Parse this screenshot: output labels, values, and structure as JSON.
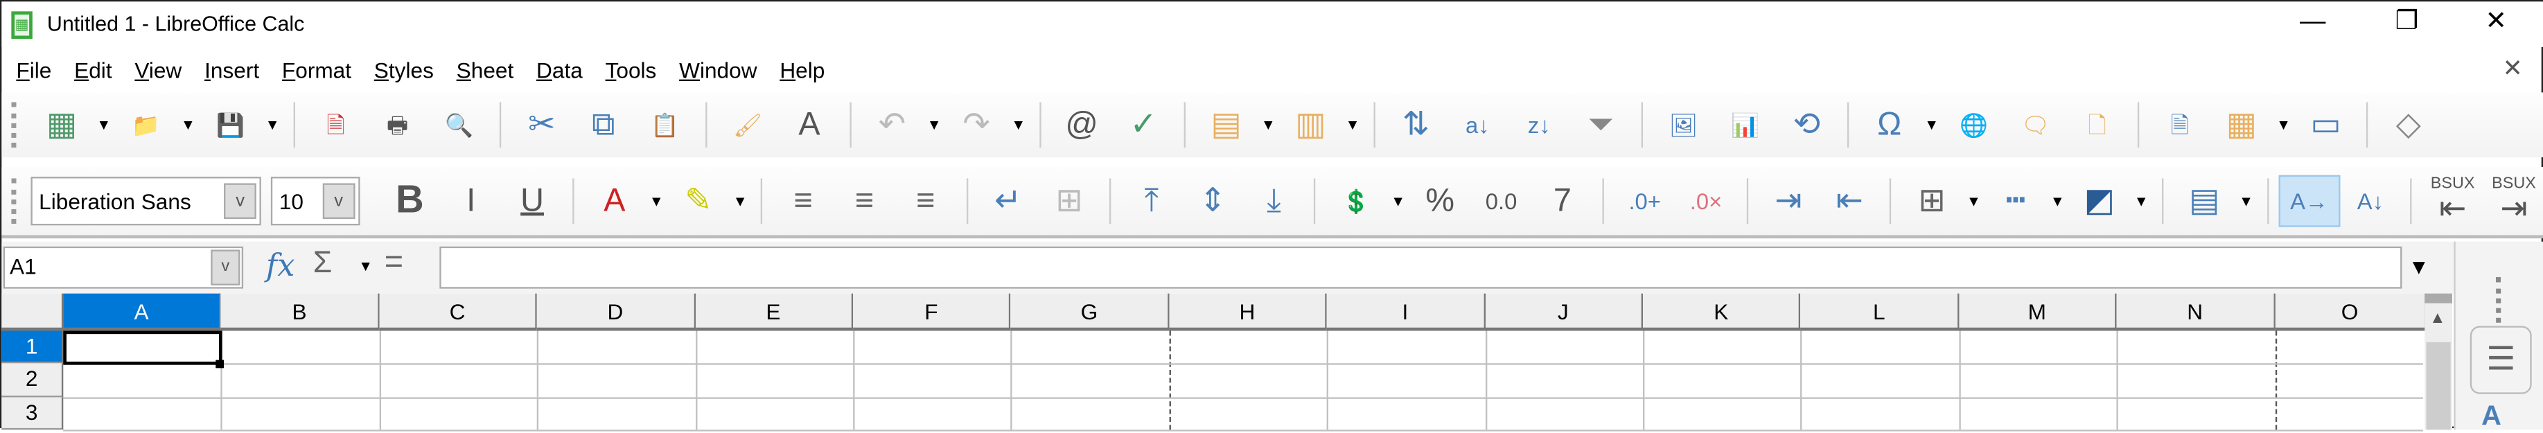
{
  "window": {
    "title": "Untitled 1 - LibreOffice Calc",
    "minimize": "—",
    "restore": "❐",
    "close": "✕"
  },
  "menu": [
    "File",
    "Edit",
    "View",
    "Insert",
    "Format",
    "Styles",
    "Sheet",
    "Data",
    "Tools",
    "Window",
    "Help"
  ],
  "doc_close": "✕",
  "toolbar_standard": [
    {
      "name": "new-spreadsheet-icon",
      "glyph": "▦",
      "color": "#4f9a6b",
      "dd": true
    },
    {
      "name": "open-folder-icon",
      "glyph": "📁",
      "color": "#e8c07a",
      "dd": true
    },
    {
      "name": "save-icon",
      "glyph": "💾",
      "color": "#8b5aa8",
      "dd": true
    },
    {
      "sep": true
    },
    {
      "name": "export-pdf-icon",
      "glyph": "🗎",
      "color": "#c33"
    },
    {
      "name": "print-icon",
      "glyph": "🖶",
      "color": "#555"
    },
    {
      "name": "print-preview-icon",
      "glyph": "🔍",
      "color": "#4a7fb8"
    },
    {
      "sep": true
    },
    {
      "name": "cut-icon",
      "glyph": "✂",
      "color": "#4a7fb8"
    },
    {
      "name": "copy-icon",
      "glyph": "⧉",
      "color": "#4a7fb8"
    },
    {
      "name": "paste-icon",
      "glyph": "📋",
      "color": "#bbb"
    },
    {
      "sep": true
    },
    {
      "name": "clone-formatting-icon",
      "glyph": "🖌",
      "color": "#e8b060"
    },
    {
      "name": "clear-formatting-icon",
      "glyph": "A",
      "color": "#555"
    },
    {
      "sep": true
    },
    {
      "name": "undo-icon",
      "glyph": "↶",
      "color": "#bbb",
      "dd": true
    },
    {
      "name": "redo-icon",
      "glyph": "↷",
      "color": "#bbb",
      "dd": true
    },
    {
      "sep": true
    },
    {
      "name": "find-replace-icon",
      "glyph": "@",
      "color": "#555"
    },
    {
      "name": "spelling-icon",
      "glyph": "✓",
      "color": "#4a9a6b"
    },
    {
      "sep": true
    },
    {
      "name": "row-icon",
      "glyph": "▤",
      "color": "#e8b060",
      "dd": true
    },
    {
      "name": "column-icon",
      "glyph": "▥",
      "color": "#e8b060",
      "dd": true
    },
    {
      "sep": true
    },
    {
      "name": "sort-icon",
      "glyph": "⇅",
      "color": "#4a7fb8"
    },
    {
      "name": "sort-ascending-icon",
      "glyph": "a↓",
      "color": "#4a7fb8"
    },
    {
      "name": "sort-descending-icon",
      "glyph": "z↓",
      "color": "#4a7fb8"
    },
    {
      "name": "autofilter-icon",
      "glyph": "⏷",
      "color": "#888"
    },
    {
      "sep": true
    },
    {
      "name": "insert-image-icon",
      "glyph": "🖼",
      "color": "#4a7fb8"
    },
    {
      "name": "insert-chart-icon",
      "glyph": "📊",
      "color": "#4a7fb8"
    },
    {
      "name": "pivot-table-icon",
      "glyph": "⟲",
      "color": "#4a7fb8"
    },
    {
      "sep": true
    },
    {
      "name": "special-character-icon",
      "glyph": "Ω",
      "color": "#4a7fb8",
      "dd": true
    },
    {
      "name": "hyperlink-icon",
      "glyph": "🌐",
      "color": "#4a7fb8"
    },
    {
      "name": "comment-icon",
      "glyph": "🗨",
      "color": "#e8b060"
    },
    {
      "name": "headers-footers-icon",
      "glyph": "🗋",
      "color": "#e8b060"
    },
    {
      "sep": true
    },
    {
      "name": "print-area-icon",
      "glyph": "🗎",
      "color": "#4a7fb8"
    },
    {
      "name": "freeze-rows-columns-icon",
      "glyph": "▦",
      "color": "#e8b060",
      "dd": true
    },
    {
      "name": "split-window-icon",
      "glyph": "▭",
      "color": "#4a7fb8"
    },
    {
      "sep": true
    },
    {
      "name": "shapes-icon",
      "glyph": "◇",
      "color": "#888"
    }
  ],
  "font_name": "Liberation Sans",
  "font_size": "10",
  "toolbar_formatting": [
    {
      "name": "bold-icon",
      "glyph": "B",
      "color": "#555",
      "bold": true
    },
    {
      "name": "italic-icon",
      "glyph": "I",
      "color": "#555"
    },
    {
      "name": "underline-icon",
      "glyph": "U",
      "color": "#555",
      "underline": true
    },
    {
      "sep": true
    },
    {
      "name": "font-color-icon",
      "glyph": "A",
      "color": "#c22",
      "dd": true
    },
    {
      "name": "highlight-color-icon",
      "glyph": "✎",
      "color": "#cc0",
      "dd": true
    },
    {
      "sep": true
    },
    {
      "name": "align-left-icon",
      "glyph": "≡",
      "color": "#666"
    },
    {
      "name": "align-center-icon",
      "glyph": "≡",
      "color": "#666"
    },
    {
      "name": "align-right-icon",
      "glyph": "≡",
      "color": "#666"
    },
    {
      "sep": true
    },
    {
      "name": "wrap-text-icon",
      "glyph": "↵",
      "color": "#4a7fb8"
    },
    {
      "name": "merge-center-icon",
      "glyph": "⊞",
      "color": "#bbb"
    },
    {
      "sep": true
    },
    {
      "name": "align-top-icon",
      "glyph": "⤒",
      "color": "#4a7fb8"
    },
    {
      "name": "align-middle-icon",
      "glyph": "⇕",
      "color": "#4a7fb8"
    },
    {
      "name": "align-bottom-icon",
      "glyph": "⤓",
      "color": "#4a7fb8"
    },
    {
      "sep": true
    },
    {
      "name": "currency-format-icon",
      "glyph": "💲",
      "color": "#4a7fb8",
      "dd": true
    },
    {
      "name": "percent-format-icon",
      "glyph": "%",
      "color": "#555"
    },
    {
      "name": "number-format-icon",
      "glyph": "0.0",
      "color": "#555"
    },
    {
      "name": "date-format-icon",
      "glyph": "7",
      "color": "#555"
    },
    {
      "sep": true
    },
    {
      "name": "add-decimal-icon",
      "glyph": ".0+",
      "color": "#4a7fb8"
    },
    {
      "name": "delete-decimal-icon",
      "glyph": ".0×",
      "color": "#e07080"
    },
    {
      "sep": true
    },
    {
      "name": "increase-indent-icon",
      "glyph": "⇥",
      "color": "#4a7fb8"
    },
    {
      "name": "decrease-indent-icon",
      "glyph": "⇤",
      "color": "#4a7fb8"
    },
    {
      "sep": true
    },
    {
      "name": "borders-icon",
      "glyph": "⊞",
      "color": "#666",
      "dd": true
    },
    {
      "name": "border-style-icon",
      "glyph": "┅",
      "color": "#4a7fb8",
      "dd": true
    },
    {
      "name": "border-color-icon",
      "glyph": "◩",
      "color": "#2a5c94",
      "dd": true
    },
    {
      "sep": true
    },
    {
      "name": "conditional-format-icon",
      "glyph": "▤",
      "color": "#4a7fb8",
      "dd": true
    },
    {
      "sep": true
    },
    {
      "name": "text-horizontal-icon",
      "glyph": "A→",
      "color": "#4a7fb8",
      "active": true
    },
    {
      "name": "text-vertical-icon",
      "glyph": "A↓",
      "color": "#4a7fb8"
    },
    {
      "sep": true
    },
    {
      "name": "left-to-right-icon",
      "glyph": "⇤",
      "color": "#555",
      "label": "BSUX"
    },
    {
      "name": "right-to-left-icon",
      "glyph": "⇥",
      "color": "#555",
      "label": "BSUX"
    }
  ],
  "formula_bar": {
    "name_box": "A1",
    "fx": "fx",
    "sum": "Σ",
    "equals": "=",
    "value": ""
  },
  "columns": [
    "A",
    "B",
    "C",
    "D",
    "E",
    "F",
    "G",
    "H",
    "I",
    "J",
    "K",
    "L",
    "M",
    "N",
    "O"
  ],
  "rows": [
    "1",
    "2",
    "3"
  ],
  "selected_cell": "A1",
  "colors": {
    "selection": "#0078d7",
    "accent": "#4a7fb8"
  }
}
